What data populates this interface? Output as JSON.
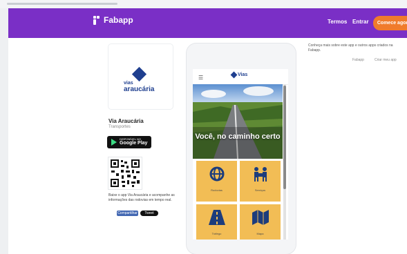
{
  "header": {
    "brand": "Fabapp",
    "nav": [
      "Termos",
      "Entrar"
    ],
    "cta": "Comece agora"
  },
  "app": {
    "logo_line1": "vias",
    "logo_line2": "araucária",
    "name": "Via Araucária",
    "subtitle": "Transportes",
    "store_small": "DISPONÍVEL NO",
    "store_big": "Google Play",
    "description": "Baixe o app Via Araucária e acompanhe as informações das rodovias em tempo real.",
    "share_fb": "Compartilhar",
    "share_tw": "Tweet"
  },
  "phone": {
    "header_logo": "Vias",
    "hero_text": "Você, no caminho certo",
    "tiles": [
      {
        "icon": "globe-icon",
        "label": "Rodovias"
      },
      {
        "icon": "people-icon",
        "label": "Serviços"
      },
      {
        "icon": "road-icon",
        "label": "Tráfego"
      },
      {
        "icon": "map-icon",
        "label": "Mapa"
      }
    ]
  },
  "right": {
    "text": "Conheça mais sobre este app e outros apps criados na Fabapp.",
    "meta1": "Fabapp",
    "meta2": "Criar meu app"
  }
}
